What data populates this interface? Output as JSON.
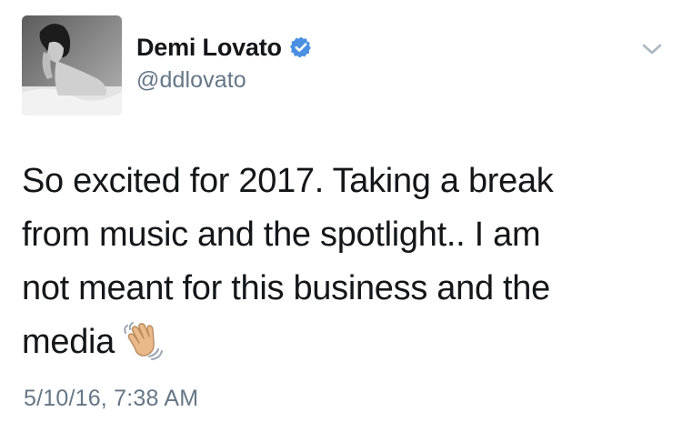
{
  "user": {
    "display_name": "Demi Lovato",
    "handle": "@ddlovato",
    "verified": true,
    "verified_color": "#4a90e2"
  },
  "tweet": {
    "text_lines": [
      "So excited for 2017. Taking a break",
      "from music and the spotlight.. I am",
      "not meant for this business and the",
      "media"
    ],
    "emoji": "waving-hand-emoji",
    "timestamp": "5/10/16, 7:38 AM"
  },
  "icons": {
    "menu": "chevron-down-icon",
    "badge": "verified-badge-icon"
  },
  "colors": {
    "text": "#14171a",
    "secondary_text": "#657786",
    "chevron": "#aab8c2"
  }
}
